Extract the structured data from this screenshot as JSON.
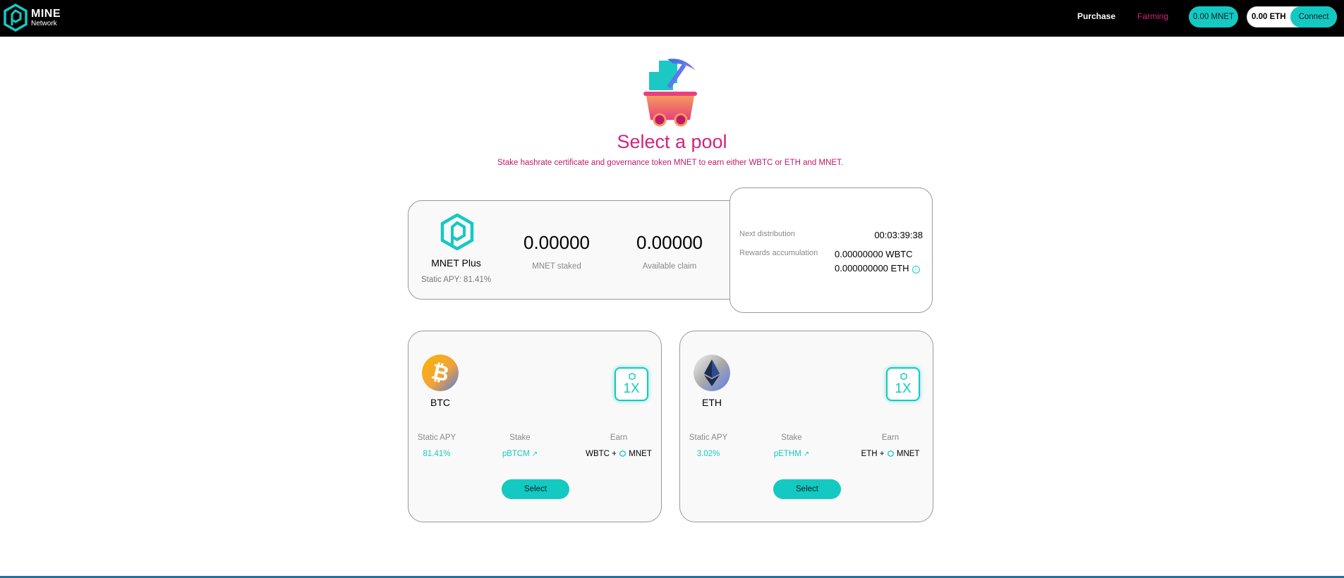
{
  "nav": {
    "logo_word": "MINE",
    "logo_sub": "Network",
    "links": [
      "Purchase",
      "Farming"
    ],
    "mnet_balance": "0.00 MNET",
    "eth_balance": "0.00 ETH",
    "connect_label": "Connect"
  },
  "hero": {
    "title": "Select a pool",
    "subtitle": "Stake hashrate certificate and governance token MNET to earn either WBTC or ETH and MNET."
  },
  "summary": {
    "pool_name": "MNET Plus",
    "static_apy": "Static APY: 81.41%",
    "mnet_staked_value": "0.00000",
    "mnet_staked_label": "MNET staked",
    "available_claim_value": "0.00000",
    "available_claim_label": "Available claim"
  },
  "distribution": {
    "next_label": "Next distribution",
    "next_time": "00:03:39:38",
    "accumulation_label": "Rewards accumulation",
    "wbtc": "0.00000000 WBTC",
    "eth": "0.000000000 ETH"
  },
  "pools": [
    {
      "name": "BTC",
      "multiplier": "1X",
      "apy_label": "Static APY",
      "apy_value": "81.41%",
      "stake_label": "Stake",
      "stake_value": "pBTCM",
      "earn_label": "Earn",
      "earn_prefix": "WBTC +",
      "earn_suffix": "MNET",
      "select_label": "Select"
    },
    {
      "name": "ETH",
      "multiplier": "1X",
      "apy_label": "Static APY",
      "apy_value": "3.02%",
      "stake_label": "Stake",
      "stake_value": "pETHM",
      "earn_label": "Earn",
      "earn_prefix": "ETH +",
      "earn_suffix": "MNET",
      "select_label": "Select"
    }
  ],
  "colors": {
    "accent": "#14c9c2",
    "brand_pink": "#d1257a",
    "nav_bg": "#000000"
  },
  "icons": [
    "mine-network-logo-icon",
    "mine-cart-pickaxe-icon",
    "mnet-token-icon",
    "bitcoin-icon",
    "ethereum-icon",
    "info-icon",
    "external-link-icon"
  ]
}
